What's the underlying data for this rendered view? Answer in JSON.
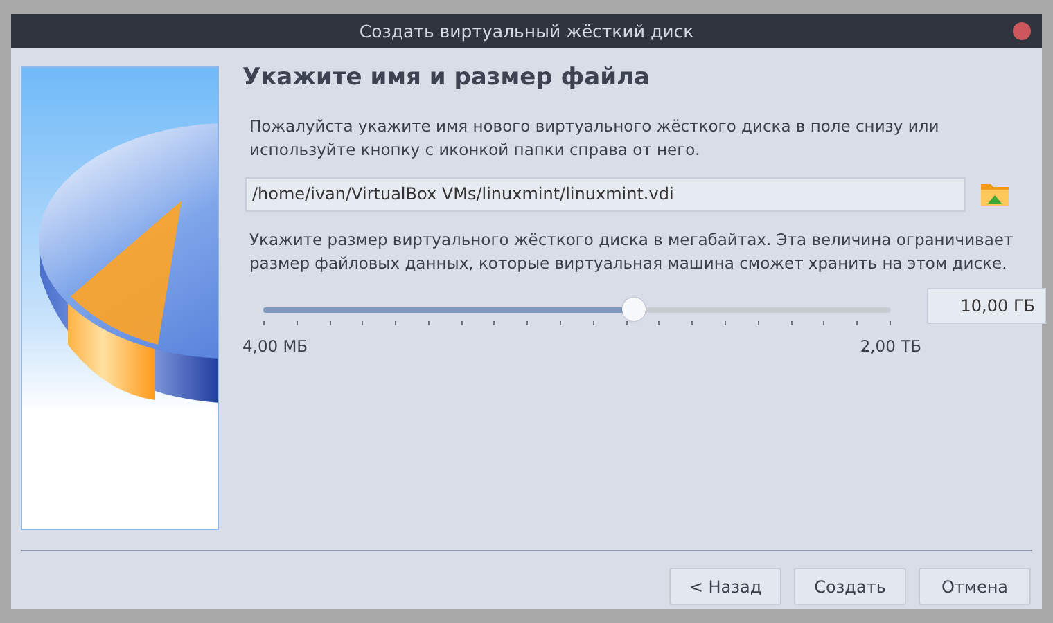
{
  "window": {
    "title": "Создать виртуальный жёсткий диск"
  },
  "heading": "Укажите имя и размер файла",
  "location_hint": "Пожалуйста укажите имя нового виртуального жёсткого диска в поле снизу или используйте кнопку с иконкой папки справа от него.",
  "file_path": "/home/ivan/VirtualBox VMs/linuxmint/linuxmint.vdi",
  "size_hint": "Укажите размер виртуального жёсткого диска в мегабайтах. Эта величина ограничивает размер файловых данных, которые виртуальная машина сможет хранить на этом диске.",
  "size_slider": {
    "level": 0.59,
    "min_label": "4,00 МБ",
    "max_label": "2,00 ТБ"
  },
  "size_value": "10,00 ГБ",
  "buttons": [
    "< Назад",
    "Создать",
    "Отмена"
  ]
}
